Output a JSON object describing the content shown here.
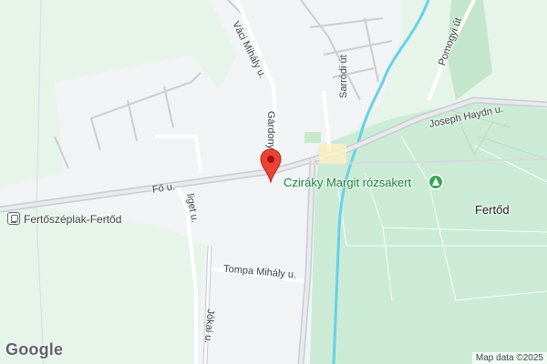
{
  "map": {
    "roads": {
      "main_road": "Fő u.",
      "vaci": "Váci Mihály u.",
      "gardonyi": "Gárdonyi",
      "sarrodi": "Sarródi út",
      "pomogyi": "Pomogyi út",
      "haydn": "Joseph Haydn u.",
      "liget": "liget u.",
      "tompa": "Tompa Mihály u.",
      "jokai": "Jókai u."
    },
    "places": {
      "station": "Fertőszéplak-Fertőd",
      "town": "Fertőd",
      "poi": "Cziráky Margit rózsakert"
    },
    "icons": {
      "station_icon": "train-station-icon",
      "poi_icon": "park-tree-icon",
      "pin_icon": "location-pin-icon"
    },
    "colors": {
      "park": "#ccebd6",
      "urban": "#f1f3f4",
      "road": "#ffffff",
      "main_road": "#c8ccd1",
      "water": "#67d1e8",
      "pin": "#ea4335"
    },
    "attribution": "Map data ©2025",
    "brand": "Google"
  }
}
